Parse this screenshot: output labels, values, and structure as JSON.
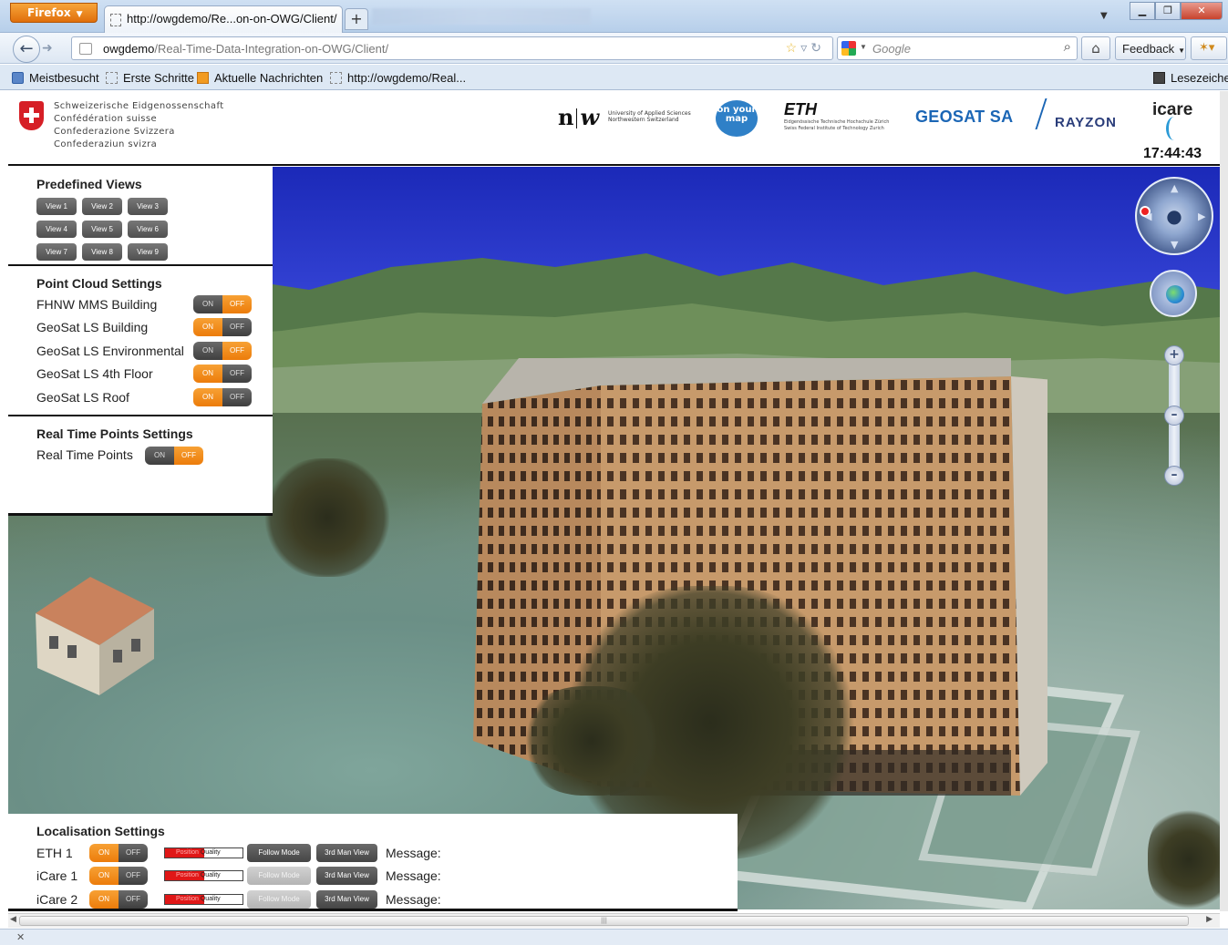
{
  "browser": {
    "app_button": "Firefox",
    "tab_title": "http://owgdemo/Re...on-on-OWG/Client/",
    "new_tab": "+",
    "url_host": "owgdemo",
    "url_path": "/Real-Time-Data-Integration-on-OWG/Client/",
    "search_placeholder": "Google",
    "feedback_label": "Feedback",
    "bookmarks": [
      "Meistbesucht",
      "Erste Schritte",
      "Aktuelle Nachrichten",
      "http://owgdemo/Real..."
    ],
    "bookmarks_menu": "Lesezeichen"
  },
  "header": {
    "confederation": [
      "Schweizerische Eidgenossenschaft",
      "Confédération suisse",
      "Confederazione Svizzera",
      "Confederaziun svizra"
    ],
    "fhnw_text": [
      "University of Applied Sciences",
      "Northwestern Switzerland"
    ],
    "onyourmap_text": "on your map",
    "eth_logo": "ETH",
    "eth_text": [
      "Eidgenössische Technische Hochschule Zürich",
      "Swiss Federal Institute of Technology Zurich"
    ],
    "geosat": "GEOSAT SA",
    "rayzon": "RAYZON",
    "icare": "icare",
    "clock": "17:44:43"
  },
  "predefined_views": {
    "title": "Predefined Views",
    "views": [
      "View 1",
      "View 2",
      "View 3",
      "View 4",
      "View 5",
      "View 6",
      "View 7",
      "View 8",
      "View 9"
    ]
  },
  "point_cloud": {
    "title": "Point Cloud Settings",
    "on_label": "ON",
    "off_label": "OFF",
    "items": [
      {
        "label": "FHNW MMS Building",
        "state": "off"
      },
      {
        "label": "GeoSat LS Building",
        "state": "on"
      },
      {
        "label": "GeoSat LS Environmental",
        "state": "off"
      },
      {
        "label": "GeoSat LS 4th Floor",
        "state": "on"
      },
      {
        "label": "GeoSat LS Roof",
        "state": "on"
      }
    ]
  },
  "real_time": {
    "title": "Real Time Points Settings",
    "items": [
      {
        "label": "Real Time Points",
        "state": "off"
      }
    ]
  },
  "localisation": {
    "title": "Localisation Settings",
    "quality_text": [
      "Position",
      "Quality"
    ],
    "follow_label": "Follow Mode",
    "third_label": "3rd Man View",
    "message_label": "Message:",
    "rows": [
      {
        "label": "ETH 1",
        "state": "on",
        "quality": 0.5,
        "follow_enabled": true
      },
      {
        "label": "iCare 1",
        "state": "on",
        "quality": 0.5,
        "follow_enabled": false
      },
      {
        "label": "iCare 2",
        "state": "on",
        "quality": 0.5,
        "follow_enabled": false
      }
    ]
  },
  "colors": {
    "toggle_active": "#ec7c0b",
    "toggle_inactive": "#4a4a4a",
    "quality_fill": "#e01717",
    "sky": "#2b3ad3"
  }
}
